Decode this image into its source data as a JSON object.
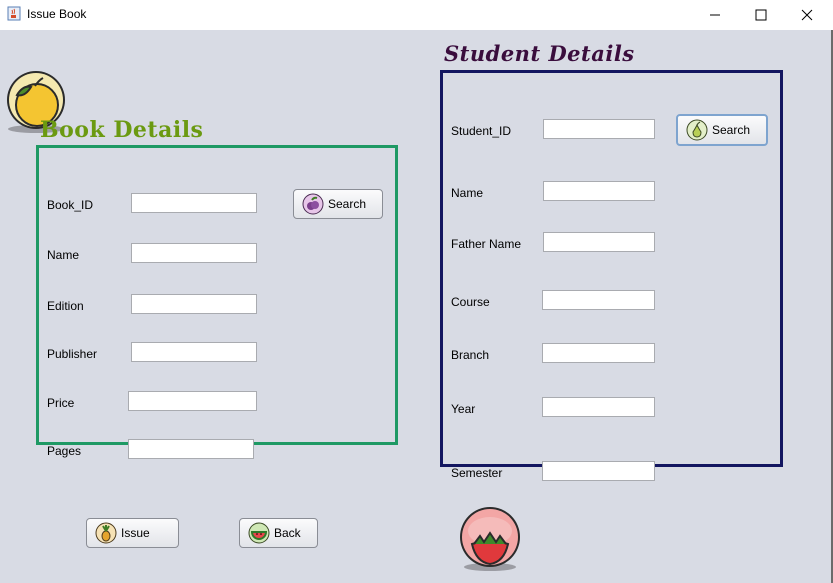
{
  "window": {
    "title": "Issue Book"
  },
  "book_panel": {
    "title": "Book Details",
    "search_label": "Search",
    "fields": [
      {
        "label": "Book_ID",
        "value": ""
      },
      {
        "label": "Name",
        "value": ""
      },
      {
        "label": "Edition",
        "value": ""
      },
      {
        "label": "Publisher",
        "value": ""
      },
      {
        "label": "Price",
        "value": ""
      },
      {
        "label": "Pages",
        "value": ""
      }
    ]
  },
  "student_panel": {
    "title": "Student Details",
    "search_label": "Search",
    "fields": [
      {
        "label": "Student_ID",
        "value": ""
      },
      {
        "label": "Name",
        "value": ""
      },
      {
        "label": "Father Name",
        "value": ""
      },
      {
        "label": "Course",
        "value": ""
      },
      {
        "label": "Branch",
        "value": ""
      },
      {
        "label": "Year",
        "value": ""
      },
      {
        "label": "Semester",
        "value": ""
      }
    ]
  },
  "actions": {
    "issue_label": "Issue",
    "back_label": "Back"
  },
  "icons": {
    "app": "java-cup-icon",
    "minimize": "minimize-icon",
    "maximize": "maximize-icon",
    "close": "close-icon",
    "top_left_logo": "lemon-icon",
    "bottom_logo": "strawberry-icon",
    "book_search": "fruit-search-icon",
    "student_search": "pear-search-icon",
    "issue": "pineapple-icon",
    "back": "watermelon-icon"
  },
  "colors": {
    "book_border": "#1e9964",
    "student_border": "#131660",
    "book_title": "#6b9a11",
    "student_title": "#3a0d3d",
    "background": "#d8dbe4"
  }
}
